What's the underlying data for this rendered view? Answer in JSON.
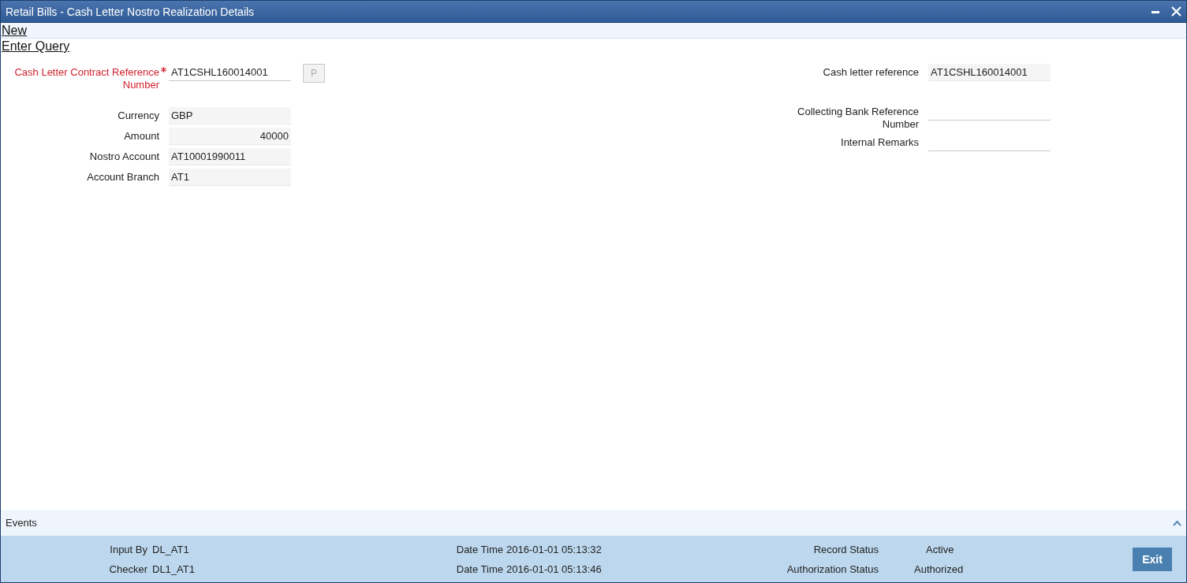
{
  "window": {
    "title": "Retail Bills - Cash Letter Nostro Realization Details"
  },
  "toolbar": [
    "New",
    "Enter Query"
  ],
  "left_fields": [
    {
      "label": "Cash Letter Contract Reference Number",
      "required": true,
      "kind": "input",
      "value": "AT1CSHL160014001",
      "button": "P"
    },
    {
      "label": "Currency",
      "required": false,
      "kind": "readonly",
      "value": "GBP"
    },
    {
      "label": "Amount",
      "required": false,
      "kind": "amount",
      "value": "40000"
    },
    {
      "label": "Nostro Account",
      "required": false,
      "kind": "readonly",
      "value": "AT10001990011"
    },
    {
      "label": "Account Branch",
      "required": false,
      "kind": "readonly",
      "value": "AT1"
    }
  ],
  "right_fields": [
    {
      "label": "Cash letter reference",
      "required": false,
      "kind": "readonly",
      "value": "AT1CSHL160014001"
    },
    {
      "label": "Collecting Bank Reference Number",
      "required": false,
      "kind": "input"
    },
    {
      "label": "Internal Remarks",
      "required": false,
      "kind": "input"
    }
  ],
  "events": {
    "label": "Events"
  },
  "audit": [
    {
      "label": "Input By",
      "value": "DL_AT1",
      "time_label": "Date Time",
      "time": "2016-01-01 05:13:32",
      "status_label": "Record Status",
      "status": "Active"
    },
    {
      "label": "Checker",
      "value": "DL1_AT1",
      "time_label": "Date Time",
      "time": "2016-01-01 05:13:46",
      "status_label": "Authorization Status",
      "status": "Authorized"
    }
  ],
  "exit_button": "Exit"
}
